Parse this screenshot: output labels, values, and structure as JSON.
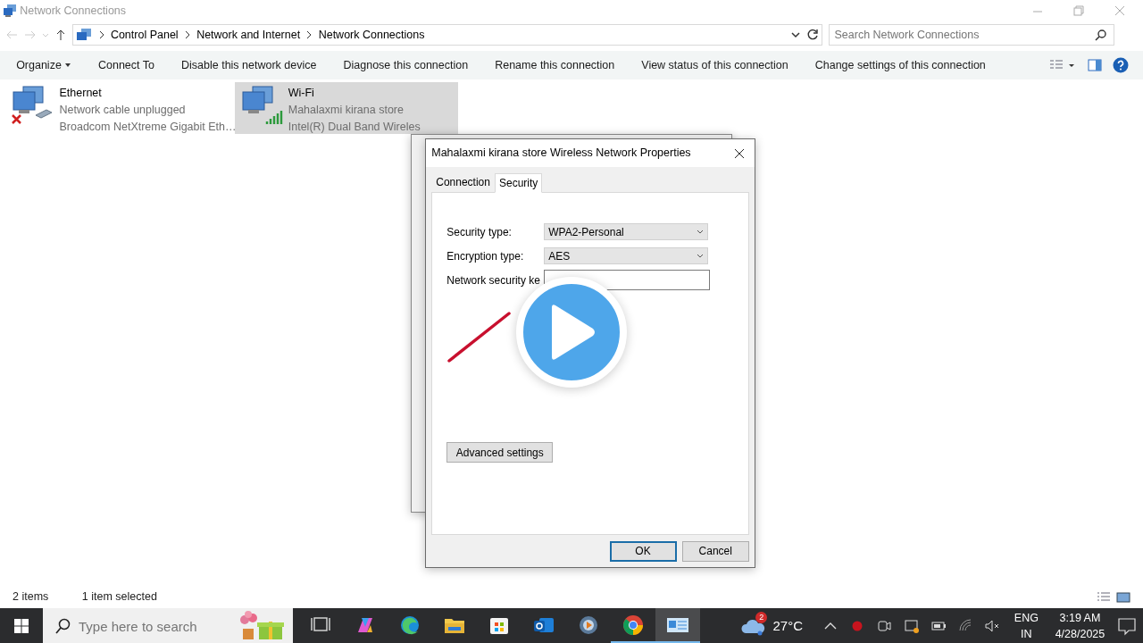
{
  "window": {
    "title": "Network Connections"
  },
  "address_bar": {
    "breadcrumbs": [
      "Control Panel",
      "Network and Internet",
      "Network Connections"
    ]
  },
  "search": {
    "placeholder": "Search Network Connections"
  },
  "commands": [
    {
      "label": "Organize",
      "dropdown": true
    },
    {
      "label": "Connect To",
      "dropdown": false
    },
    {
      "label": "Disable this network device",
      "dropdown": false
    },
    {
      "label": "Diagnose this connection",
      "dropdown": false
    },
    {
      "label": "Rename this connection",
      "dropdown": false
    },
    {
      "label": "View status of this connection",
      "dropdown": false
    },
    {
      "label": "Change settings of this connection",
      "dropdown": false
    }
  ],
  "connections": [
    {
      "name": "Ethernet",
      "status": "Network cable unplugged",
      "adapter": "Broadcom NetXtreme Gigabit Eth…",
      "kind": "wired",
      "connected": false,
      "selected": false
    },
    {
      "name": "Wi-Fi",
      "status": "Mahalaxmi kirana store",
      "adapter": "Intel(R) Dual Band Wireles",
      "kind": "wireless",
      "connected": true,
      "selected": true
    }
  ],
  "status_bar": {
    "count": "2 items",
    "selection": "1 item selected"
  },
  "properties_dialog": {
    "title": "Mahalaxmi kirana store Wireless Network Properties",
    "tabs": [
      {
        "label": "Connection",
        "selected": false
      },
      {
        "label": "Security",
        "selected": true
      }
    ],
    "fields": [
      {
        "label": "Security type:",
        "kind": "select",
        "value": "WPA2-Personal"
      },
      {
        "label": "Encryption type:",
        "kind": "select",
        "value": "AES"
      },
      {
        "label": "Network security ke",
        "kind": "text"
      }
    ],
    "advanced_button": "Advanced settings",
    "buttons": [
      {
        "label": "OK",
        "default": true
      },
      {
        "label": "Cancel",
        "default": false
      }
    ]
  },
  "taskbar": {
    "search_placeholder": "Type here to search",
    "apps": [
      {
        "kind": "task-view",
        "running": false,
        "selected": false
      },
      {
        "kind": "copilot",
        "running": false,
        "selected": false
      },
      {
        "kind": "edge",
        "running": false,
        "selected": false
      },
      {
        "kind": "folder",
        "running": false,
        "selected": false
      },
      {
        "kind": "store",
        "running": false,
        "selected": false
      },
      {
        "kind": "outlook",
        "running": false,
        "selected": false
      },
      {
        "kind": "media",
        "running": false,
        "selected": false
      },
      {
        "kind": "chrome",
        "running": true,
        "selected": false
      },
      {
        "kind": "control-panel",
        "running": true,
        "selected": true
      }
    ],
    "weather": {
      "badge": "2",
      "temperature": "27°C"
    },
    "language": [
      "ENG",
      "IN"
    ],
    "time": "3:19 AM",
    "date": "4/28/2025"
  }
}
